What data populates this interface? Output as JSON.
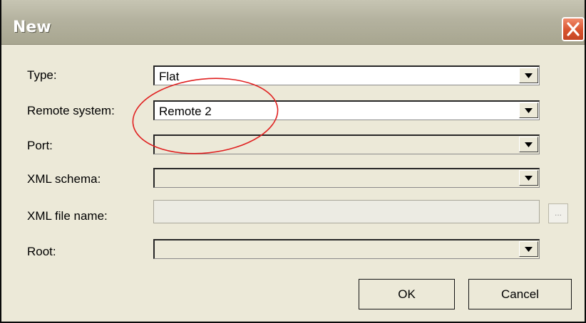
{
  "dialog": {
    "title": "New"
  },
  "fields": {
    "type": {
      "label": "Type:",
      "value": "Flat"
    },
    "remote_system": {
      "label": "Remote system:",
      "value": "Remote 2"
    },
    "port": {
      "label": "Port:",
      "value": ""
    },
    "xml_schema": {
      "label": "XML schema:",
      "value": ""
    },
    "xml_file_name": {
      "label": "XML file name:",
      "value": "",
      "browse_label": "..."
    },
    "root": {
      "label": "Root:",
      "value": ""
    }
  },
  "buttons": {
    "ok": "OK",
    "cancel": "Cancel"
  },
  "icons": {
    "close": "close-icon",
    "dropdown": "chevron-down-icon"
  },
  "colors": {
    "annotation": "#e02020",
    "close_button": "#d8532e"
  }
}
